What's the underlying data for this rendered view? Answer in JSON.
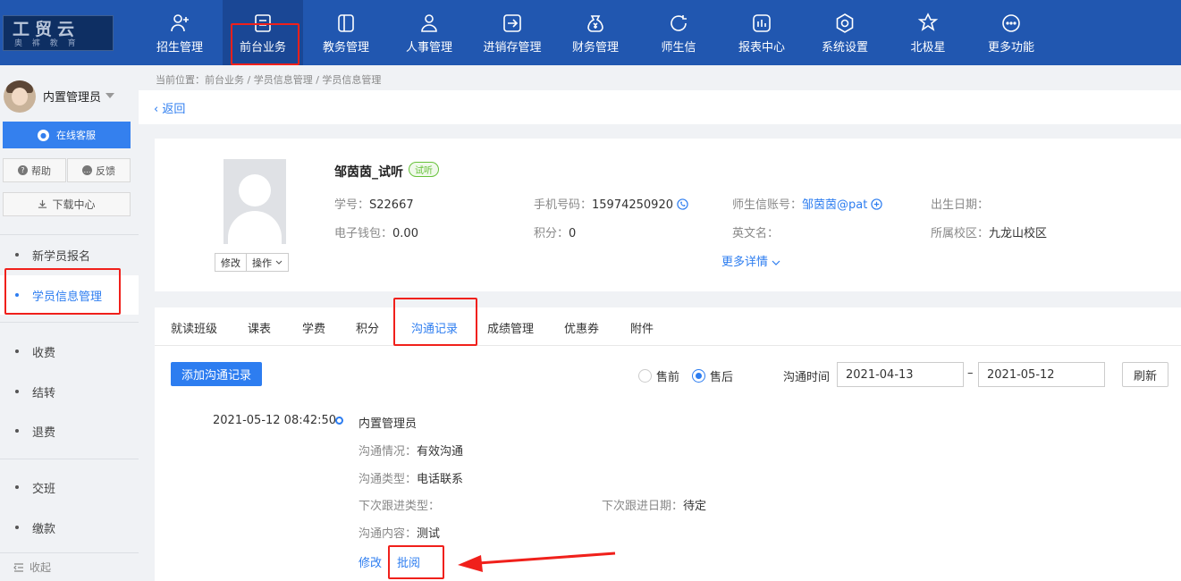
{
  "header": {
    "logo": {
      "line1": "工贸云",
      "line2": "奥 裤 教 育"
    },
    "nav": [
      {
        "label": "招生管理",
        "icon": "person-add-icon"
      },
      {
        "label": "前台业务",
        "icon": "desk-icon"
      },
      {
        "label": "教务管理",
        "icon": "book-icon"
      },
      {
        "label": "人事管理",
        "icon": "person-icon"
      },
      {
        "label": "进销存管理",
        "icon": "arrow-box-icon"
      },
      {
        "label": "财务管理",
        "icon": "money-bag-icon"
      },
      {
        "label": "师生信",
        "icon": "chat-icon"
      },
      {
        "label": "报表中心",
        "icon": "report-icon"
      },
      {
        "label": "系统设置",
        "icon": "settings-icon"
      },
      {
        "label": "北极星",
        "icon": "star-icon"
      },
      {
        "label": "更多功能",
        "icon": "more-icon"
      }
    ],
    "active_index": 1
  },
  "sidebar": {
    "user_name": "内置管理员",
    "online_service": "在线客服",
    "help": "帮助",
    "feedback": "反馈",
    "download_center": "下载中心",
    "menu_group1": [
      "新学员报名",
      "学员信息管理"
    ],
    "menu_group2": [
      "收费",
      "结转",
      "退费"
    ],
    "menu_group3": [
      "交班",
      "缴款"
    ],
    "active_item": "学员信息管理",
    "collapse": "收起"
  },
  "breadcrumb": "当前位置：前台业务 / 学员信息管理 / 学员信息管理",
  "back_label": "返回",
  "student": {
    "name": "邹茵茵_试听",
    "tag": "试听",
    "edit": "修改",
    "ops": "操作",
    "fields": {
      "student_no_label": "学号：",
      "student_no": "S22667",
      "phone_label": "手机号码：",
      "phone": "15974250920",
      "account_label": "师生信账号：",
      "account": "邹茵茵@pat",
      "birthday_label": "出生日期：",
      "birthday": "",
      "wallet_label": "电子钱包：",
      "wallet": "0.00",
      "points_label": "积分：",
      "points": "0",
      "english_label": "英文名：",
      "english": "",
      "campus_label": "所属校区：",
      "campus": "九龙山校区"
    },
    "more_details": "更多详情"
  },
  "tabs": [
    "就读班级",
    "课表",
    "学费",
    "积分",
    "沟通记录",
    "成绩管理",
    "优惠券",
    "附件"
  ],
  "active_tab": "沟通记录",
  "toolbar": {
    "add_button": "添加沟通记录",
    "radio_presale": "售前",
    "radio_aftersale": "售后",
    "selected_radio": "售后",
    "time_label": "沟通时间",
    "date_from": "2021-04-13",
    "date_sep": "–",
    "date_to": "2021-05-12",
    "refresh": "刷新"
  },
  "record": {
    "time": "2021-05-12 08:42:50",
    "operator": "内置管理员",
    "situation_label": "沟通情况：",
    "situation": "有效沟通",
    "type_label": "沟通类型：",
    "type": "电话联系",
    "next_type_label": "下次跟进类型：",
    "next_type": "",
    "next_date_label": "下次跟进日期：",
    "next_date": "待定",
    "content_label": "沟通内容：",
    "content": "测试",
    "edit": "修改",
    "review": "批阅"
  },
  "colors": {
    "primary": "#2d7df0",
    "header": "#2157b0",
    "annotation": "#f0201b",
    "tag_green": "#67c23a"
  }
}
